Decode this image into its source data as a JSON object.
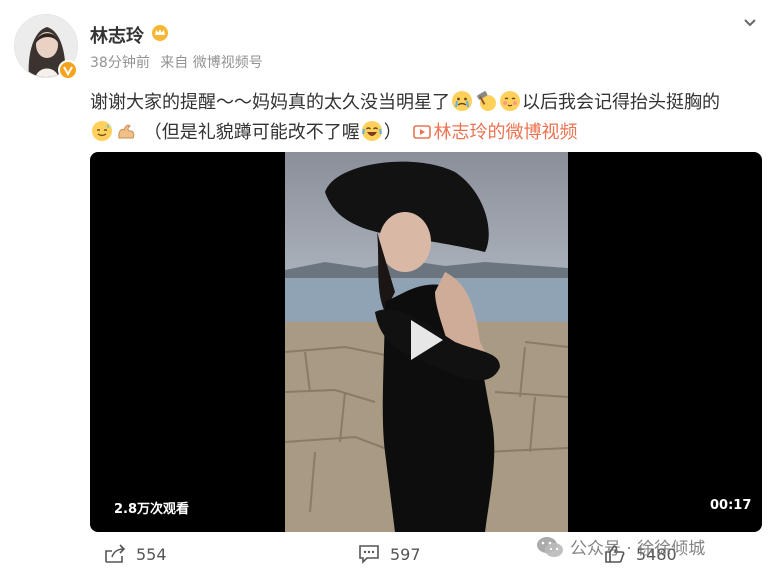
{
  "user": {
    "name": "林志玲",
    "crown_icon": "crown-icon",
    "verified_badge_icon": "verified-badge-icon"
  },
  "meta": {
    "time": "38分钟前",
    "source": "来自 微博视频号"
  },
  "post": {
    "text_line1_a": "谢谢大家的提醒～～妈妈真的太久没当明星了",
    "text_line1_b": "以后我会记得抬头挺胸的",
    "text_line2": "（但是礼貌蹲可能改不了喔",
    "text_line2_end": "）",
    "video_link_text": "林志玲的微博视频"
  },
  "video": {
    "views": "2.8万次观看",
    "duration": "00:17"
  },
  "actions": {
    "share_count": "554",
    "comment_count": "597",
    "like_count": "5480"
  },
  "watermark": {
    "text": "公众号 · 徐徐倾城"
  },
  "colors": {
    "link": "#eb7350",
    "badge": "#f7a21c",
    "text": "#333333",
    "meta": "#939393"
  }
}
